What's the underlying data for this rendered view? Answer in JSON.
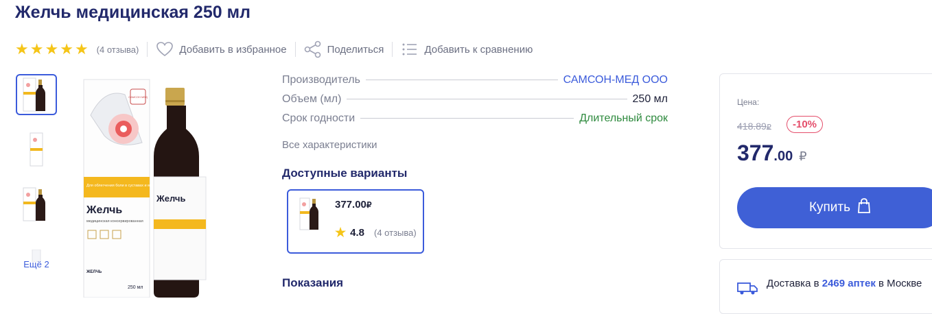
{
  "product": {
    "title": "Желчь медицинская 250 мл"
  },
  "rating": {
    "stars": 5,
    "reviews": "(4 отзыва)"
  },
  "actions": {
    "favorite": "Добавить в избранное",
    "share": "Поделиться",
    "compare": "Добавить к сравнению"
  },
  "gallery": {
    "more": "Ещё 2"
  },
  "specs": [
    {
      "label": "Производитель",
      "value": "САМСОН-МЕД ООО",
      "color": "#3b5bdb"
    },
    {
      "label": "Объем (мл)",
      "value": "250 мл",
      "color": "#1d2038"
    },
    {
      "label": "Срок годности",
      "value": "Длительный срок",
      "color": "#2e8a3e"
    }
  ],
  "all_characteristics": "Все характеристики",
  "variants": {
    "title": "Доступные варианты",
    "price": "377.00",
    "currency": "₽",
    "rating": "4.8",
    "reviews": "(4 отзыва)"
  },
  "indications": "Показания",
  "price_panel": {
    "label": "Цена:",
    "old_price": "418.89",
    "currency": "₽",
    "discount": "-10%",
    "price_int": "377",
    "price_dec": ".00",
    "buy": "Купить"
  },
  "delivery": {
    "prefix": "Доставка в ",
    "count": "2469 аптек",
    "suffix": " в Москве"
  },
  "packaging": {
    "brand": "САМСОН МЕД",
    "banner": "Для облегчения боли в суставах и мышцах",
    "name": "Желчь",
    "subtitle": "медицинская консервированная",
    "small_name": "ЖЕЛЧЬ",
    "volume": "250 мл"
  }
}
